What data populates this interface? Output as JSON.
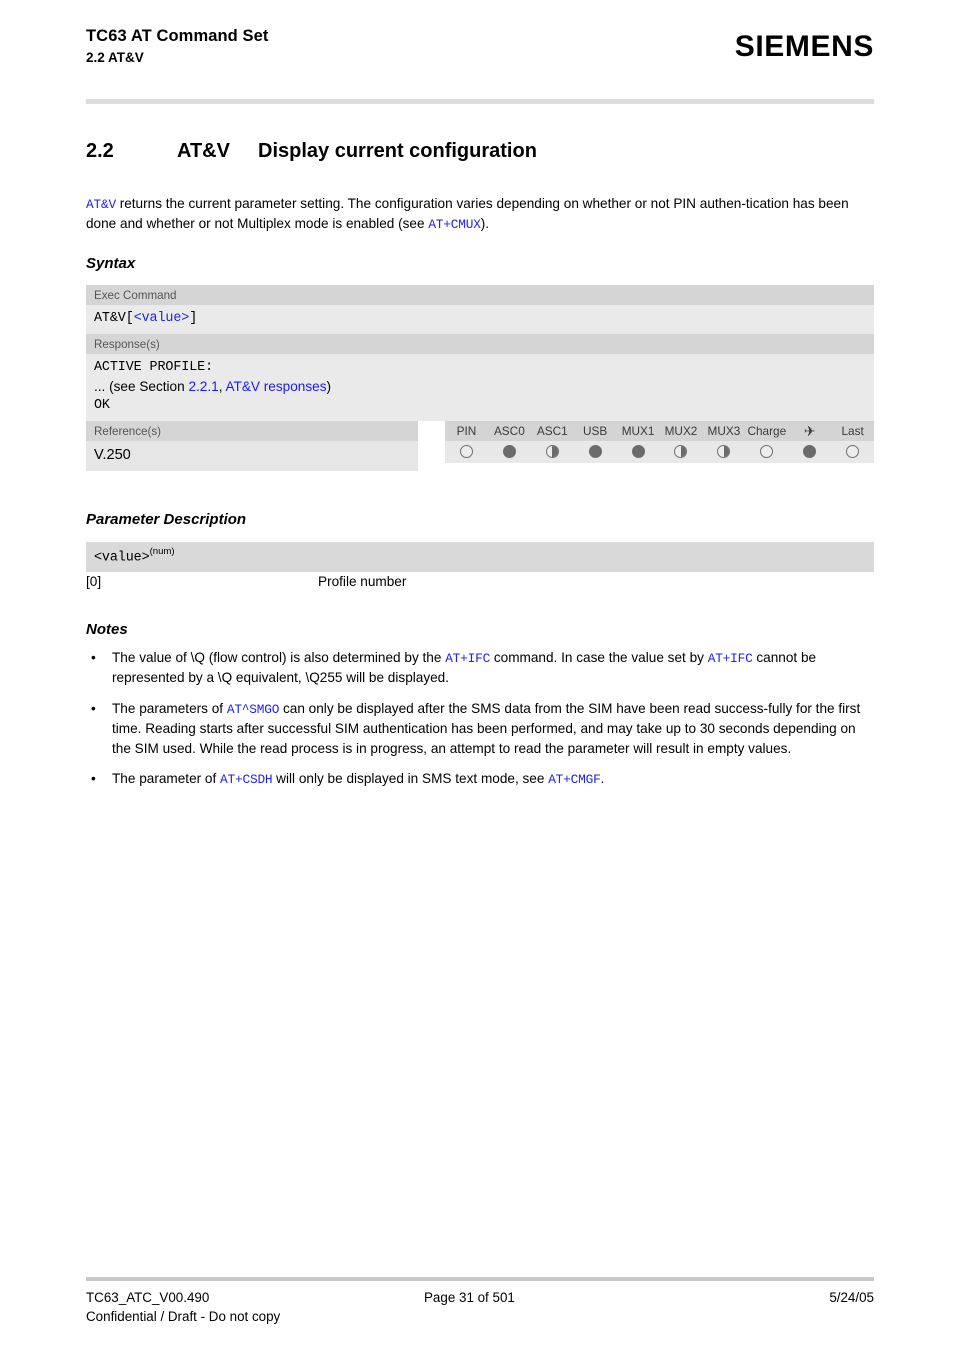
{
  "header": {
    "title": "TC63 AT Command Set",
    "subtitle": "2.2 AT&V",
    "logo": "SIEMENS"
  },
  "section": {
    "number": "2.2",
    "command": "AT&V",
    "title": "Display current configuration"
  },
  "intro": {
    "cmd1": "AT&V",
    "text1": " returns the current parameter setting. The configuration varies depending on whether or not PIN authen-",
    "text2": "tication has been done and whether or not Multiplex mode is enabled (see ",
    "cmd2": "AT+CMUX",
    "text3": ")."
  },
  "headings": {
    "syntax": "Syntax",
    "parameter_description": "Parameter Description",
    "notes": "Notes"
  },
  "syntax": {
    "exec_label": "Exec Command",
    "exec_code_pre": "AT&V[",
    "exec_code_param": "<value>",
    "exec_code_post": "]",
    "response_label": "Response(s)",
    "response_line1": "ACTIVE PROFILE:",
    "response_line2_pre": "... (see Section ",
    "response_line2_link1": "2.2.1",
    "response_line2_sep": ", ",
    "response_line2_link2": "AT&V responses",
    "response_line2_post": ")",
    "response_line3": "OK"
  },
  "reference": {
    "label": "Reference(s)",
    "value": "V.250"
  },
  "indicators": {
    "columns": [
      {
        "label": "PIN",
        "state": "empty"
      },
      {
        "label": "ASC0",
        "state": "full"
      },
      {
        "label": "ASC1",
        "state": "half"
      },
      {
        "label": "USB",
        "state": "full"
      },
      {
        "label": "MUX1",
        "state": "full"
      },
      {
        "label": "MUX2",
        "state": "half"
      },
      {
        "label": "MUX3",
        "state": "half"
      },
      {
        "label": "Charge",
        "state": "empty"
      },
      {
        "label": "✈",
        "state": "full",
        "icon": "airplane-icon"
      },
      {
        "label": "Last",
        "state": "empty"
      }
    ]
  },
  "parameter": {
    "name": "<value>",
    "type": "(num)",
    "key": "[0]",
    "desc": "Profile number"
  },
  "notes": [
    {
      "parts": [
        {
          "t": "text",
          "v": "The value of \\Q (flow control) is also determined by the "
        },
        {
          "t": "cmd",
          "v": "AT+IFC"
        },
        {
          "t": "text",
          "v": " command. In case the value set by "
        },
        {
          "t": "cmd",
          "v": "AT+IFC"
        },
        {
          "t": "text",
          "v": " cannot be represented by a \\Q equivalent, \\Q255 will be displayed."
        }
      ]
    },
    {
      "parts": [
        {
          "t": "text",
          "v": "The parameters of "
        },
        {
          "t": "cmd",
          "v": "AT^SMGO"
        },
        {
          "t": "text",
          "v": " can only be displayed after the SMS data from the SIM have been read success-fully for the first time. Reading starts after successful SIM authentication has been performed, and may take up to 30 seconds depending on the SIM used. While the read process is in progress, an attempt to read the parameter will result in empty values."
        }
      ]
    },
    {
      "parts": [
        {
          "t": "text",
          "v": "The parameter of "
        },
        {
          "t": "cmd",
          "v": "AT+CSDH"
        },
        {
          "t": "text",
          "v": " will only be displayed in SMS text mode, see "
        },
        {
          "t": "cmd",
          "v": "AT+CMGF"
        },
        {
          "t": "text",
          "v": "."
        }
      ]
    }
  ],
  "bullet_char": "•",
  "footer": {
    "doc_id": "TC63_ATC_V00.490",
    "page": "Page 31 of 501",
    "date": "5/24/05",
    "confidential": "Confidential / Draft - Do not copy"
  },
  "colors": {
    "link": "#1a1af0",
    "code": "#2222dd",
    "header_band": "#d5d5d5",
    "body_band": "#eaeaea",
    "rule": "#dcdcdc"
  }
}
